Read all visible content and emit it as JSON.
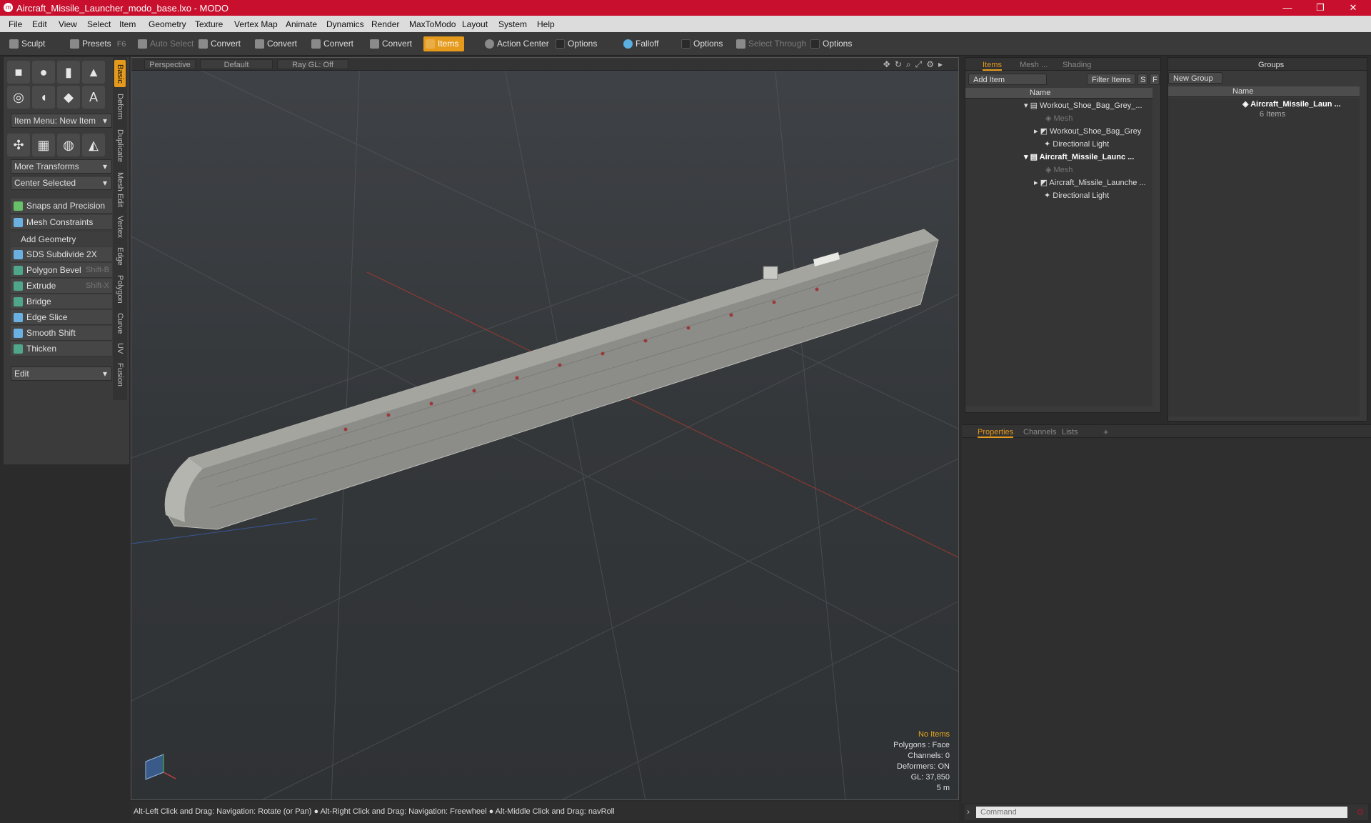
{
  "window": {
    "title": "Aircraft_Missile_Launcher_modo_base.lxo - MODO"
  },
  "menu": [
    "File",
    "Edit",
    "View",
    "Select",
    "Item",
    "Geometry",
    "Texture",
    "Vertex Map",
    "Animate",
    "Dynamics",
    "Render",
    "MaxToModo",
    "Layout",
    "System",
    "Help"
  ],
  "toolbar": {
    "sculpt": "Sculpt",
    "presets": "Presets",
    "presets_key": "F6",
    "auto_select": "Auto Select",
    "convert1": "Convert",
    "convert2": "Convert",
    "convert3": "Convert",
    "convert4": "Convert",
    "items": "Items",
    "action_center": "Action Center",
    "options1": "Options",
    "falloff": "Falloff",
    "options2": "Options",
    "select_through": "Select Through",
    "options3": "Options"
  },
  "left_panel": {
    "item_menu": "Item Menu: New Item",
    "more_transforms": "More Transforms",
    "center_selected": "Center Selected",
    "snaps": "Snaps and Precision",
    "mesh_constraints": "Mesh Constraints",
    "add_geometry": "Add Geometry",
    "tools": [
      {
        "label": "SDS Subdivide 2X",
        "key": ""
      },
      {
        "label": "Polygon Bevel",
        "key": "Shift-B"
      },
      {
        "label": "Extrude",
        "key": "Shift-X"
      },
      {
        "label": "Bridge",
        "key": ""
      },
      {
        "label": "Edge Slice",
        "key": ""
      },
      {
        "label": "Smooth Shift",
        "key": ""
      },
      {
        "label": "Thicken",
        "key": ""
      }
    ],
    "edit": "Edit",
    "vtabs": [
      "Basic",
      "Deform",
      "Duplicate",
      "Mesh Edit",
      "Vertex",
      "Edge",
      "Polygon",
      "Curve",
      "UV",
      "Fusion"
    ]
  },
  "viewport": {
    "view": "Perspective",
    "shading": "Default",
    "raygl": "Ray GL: Off",
    "info": [
      "No Items",
      "Polygons : Face",
      "Channels: 0",
      "Deformers: ON",
      "GL: 37,850",
      "5 m"
    ]
  },
  "statusbar": "Alt-Left Click and Drag: Navigation: Rotate (or Pan) ● Alt-Right Click and Drag: Navigation: Freewheel ● Alt-Middle Click and Drag: navRoll",
  "items_panel": {
    "tabs": [
      "Items",
      "Mesh ...",
      "Shading"
    ],
    "add_item": "Add Item",
    "filter_items": "Filter Items",
    "s": "S",
    "f": "F",
    "col_name": "Name",
    "rows": [
      {
        "label": "Workout_Shoe_Bag_Grey_...",
        "indent": 0,
        "style": "normal"
      },
      {
        "label": "Mesh",
        "indent": 2,
        "style": "dim"
      },
      {
        "label": "Workout_Shoe_Bag_Grey",
        "indent": 1,
        "style": "normal"
      },
      {
        "label": "Directional Light",
        "indent": 1,
        "style": "normal"
      },
      {
        "label": "Aircraft_Missile_Launc ...",
        "indent": 0,
        "style": "bold"
      },
      {
        "label": "Mesh",
        "indent": 2,
        "style": "dim"
      },
      {
        "label": "Aircraft_Missile_Launche ...",
        "indent": 1,
        "style": "normal"
      },
      {
        "label": "Directional Light",
        "indent": 1,
        "style": "normal"
      }
    ]
  },
  "groups_panel": {
    "title": "Groups",
    "new_group": "New Group",
    "col_name": "Name",
    "group_name": "Aircraft_Missile_Laun ...",
    "group_count": "6 Items"
  },
  "props_panel": {
    "tabs": [
      "Properties",
      "Channels",
      "Lists"
    ],
    "plus": "+"
  },
  "command": {
    "placeholder": "Command"
  },
  "colors": {
    "accent": "#e59a1c",
    "titlebar": "#c8102e"
  }
}
